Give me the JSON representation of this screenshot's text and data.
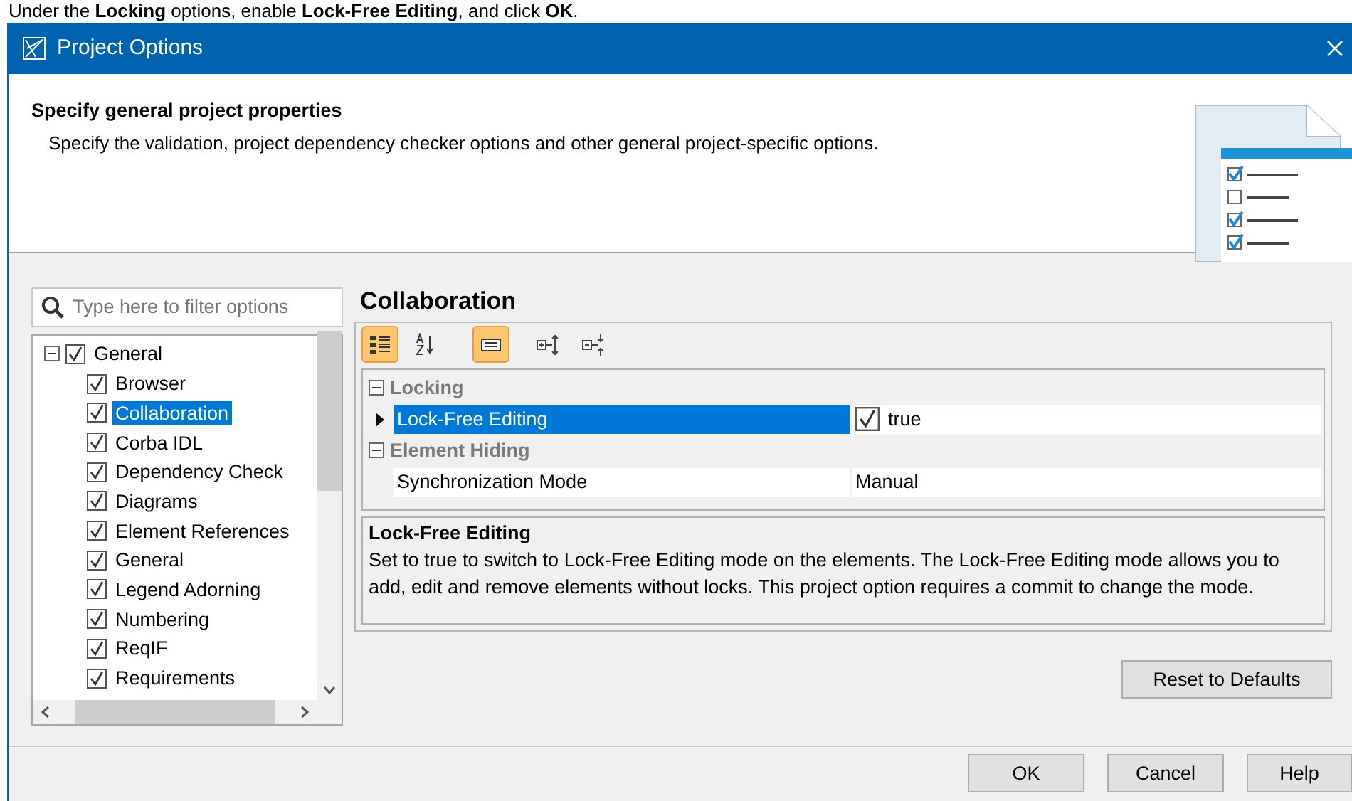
{
  "instruction": "Under the **Locking** options, enable **Lock-Free Editing**, and click **OK**.",
  "window": {
    "title": "Project Options"
  },
  "header": {
    "title": "Specify general project properties",
    "description": "Specify the validation, project dependency checker options and other general project-specific options."
  },
  "filter": {
    "placeholder": "Type here to filter options"
  },
  "tree": [
    {
      "label": "General",
      "checked": true,
      "expanded": true,
      "selected": false,
      "children": [
        {
          "label": "Browser",
          "checked": true,
          "selected": false
        },
        {
          "label": "Collaboration",
          "checked": true,
          "selected": true
        },
        {
          "label": "Corba IDL",
          "checked": true,
          "selected": false
        },
        {
          "label": "Dependency Check",
          "checked": true,
          "selected": false
        },
        {
          "label": "Diagrams",
          "checked": true,
          "selected": false
        },
        {
          "label": "Element References",
          "checked": true,
          "selected": false
        },
        {
          "label": "General",
          "checked": true,
          "selected": false
        },
        {
          "label": "Legend Adorning",
          "checked": true,
          "selected": false
        },
        {
          "label": "Numbering",
          "checked": true,
          "selected": false
        },
        {
          "label": "ReqIF",
          "checked": true,
          "selected": false
        },
        {
          "label": "Requirements",
          "checked": true,
          "selected": false
        }
      ]
    }
  ],
  "panel": {
    "title": "Collaboration",
    "toolbar": [
      {
        "kind": "categorized",
        "selected": true
      },
      {
        "kind": "sort",
        "selected": false
      },
      {
        "kind": "description",
        "selected": true
      },
      {
        "kind": "expand",
        "selected": false
      },
      {
        "kind": "collapse",
        "selected": false
      }
    ],
    "groups": [
      {
        "label": "Locking",
        "expanded": true,
        "rows": [
          {
            "name": "Lock-Free Editing",
            "kind": "checkbox",
            "checked": true,
            "value": "true",
            "selected": true
          }
        ]
      },
      {
        "label": "Element Hiding",
        "expanded": true,
        "rows": [
          {
            "name": "Synchronization Mode",
            "kind": "text",
            "value": "Manual",
            "selected": false
          }
        ]
      }
    ],
    "description": {
      "title": "Lock-Free Editing",
      "text": "Set to true to switch to Lock-Free Editing mode on the elements. The Lock-Free Editing mode allows you to add, edit and remove elements without locks. This project option requires a commit to change the mode."
    },
    "reset_button": "Reset to Defaults"
  },
  "buttons": [
    "OK",
    "Cancel",
    "Help"
  ]
}
